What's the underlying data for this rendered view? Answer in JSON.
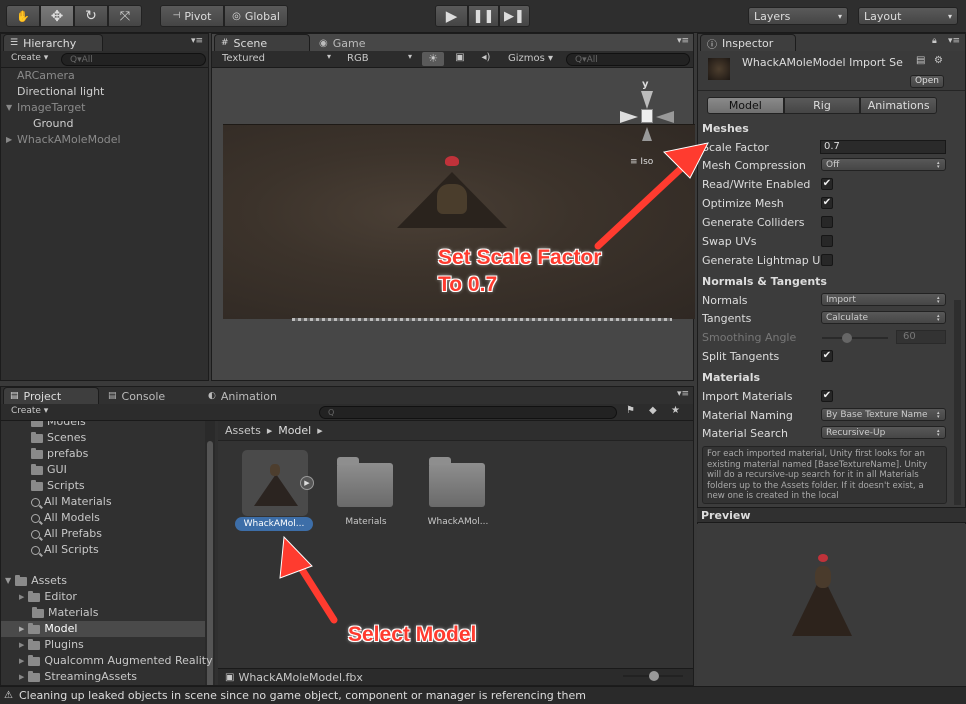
{
  "toolbar": {
    "pivot_label": "Pivot",
    "global_label": "Global",
    "layers_label": "Layers",
    "layout_label": "Layout"
  },
  "hierarchy": {
    "tab_label": "Hierarchy",
    "create_label": "Create ▾",
    "search_placeholder": "Q▾All",
    "items": [
      {
        "label": "ARCamera"
      },
      {
        "label": "Directional light"
      },
      {
        "label": "ImageTarget"
      },
      {
        "label": "Ground"
      },
      {
        "label": "WhackAMoleModel"
      }
    ]
  },
  "scene": {
    "tab_label": "Scene",
    "game_tab_label": "Game",
    "shading_mode": "Textured",
    "render_mode": "RGB",
    "gizmos_label": "Gizmos ▾",
    "search_placeholder": "Q▾All",
    "gizmo_y": "y",
    "gizmo_iso": "Iso"
  },
  "project": {
    "tab_label": "Project",
    "console_tab_label": "Console",
    "animation_tab_label": "Animation",
    "create_label": "Create ▾",
    "tree": [
      {
        "label": "Models",
        "type": "folder"
      },
      {
        "label": "Scenes",
        "type": "folder"
      },
      {
        "label": "prefabs",
        "type": "folder"
      },
      {
        "label": "GUI",
        "type": "folder"
      },
      {
        "label": "Scripts",
        "type": "folder"
      },
      {
        "label": "All Materials",
        "type": "search"
      },
      {
        "label": "All Models",
        "type": "search"
      },
      {
        "label": "All Prefabs",
        "type": "search"
      },
      {
        "label": "All Scripts",
        "type": "search"
      }
    ],
    "assets_root": "Assets",
    "asset_folders": [
      {
        "label": "Editor"
      },
      {
        "label": "Materials"
      },
      {
        "label": "Model"
      },
      {
        "label": "Plugins"
      },
      {
        "label": "Qualcomm Augmented Reality"
      },
      {
        "label": "StreamingAssets"
      }
    ],
    "breadcrumb": [
      "Assets",
      "Model"
    ],
    "grid_items": [
      {
        "label": "WhackAMol..."
      },
      {
        "label": "Materials"
      },
      {
        "label": "WhackAMol..."
      }
    ],
    "footer_file": "WhackAMoleModel.fbx"
  },
  "inspector": {
    "tab_label": "Inspector",
    "title": "WhackAMoleModel Import Se",
    "open_label": "Open",
    "tabs": [
      "Model",
      "Rig",
      "Animations"
    ],
    "meshes_header": "Meshes",
    "scale_factor_label": "Scale Factor",
    "scale_factor_value": "0.7",
    "mesh_compression_label": "Mesh Compression",
    "mesh_compression_value": "Off",
    "read_write_label": "Read/Write Enabled",
    "optimize_mesh_label": "Optimize Mesh",
    "generate_colliders_label": "Generate Colliders",
    "swap_uvs_label": "Swap UVs",
    "lightmap_uvs_label": "Generate Lightmap UV",
    "normals_header": "Normals & Tangents",
    "normals_label": "Normals",
    "normals_value": "Import",
    "tangents_label": "Tangents",
    "tangents_value": "Calculate",
    "smoothing_label": "Smoothing Angle",
    "smoothing_value": "60",
    "split_tangents_label": "Split Tangents",
    "materials_header": "Materials",
    "import_materials_label": "Import Materials",
    "material_naming_label": "Material Naming",
    "material_naming_value": "By Base Texture Name",
    "material_search_label": "Material Search",
    "material_search_value": "Recursive-Up",
    "help_text": "For each imported material, Unity first looks for an existing material named [BaseTextureName]. Unity will do a recursive-up search for it in all Materials folders up to the Assets folder. If it doesn't exist, a new one is created in the local",
    "preview_label": "Preview"
  },
  "annotations": {
    "scale_callout_line1": "Set Scale Factor",
    "scale_callout_line2": "To 0.7",
    "select_callout": "Select Model"
  },
  "status_bar": {
    "message": "Cleaning up leaked objects in scene since no game object, component or manager is referencing them"
  },
  "colors": {
    "annotation_red": "#ff3b2f",
    "selection_blue": "#3d6ea8"
  }
}
